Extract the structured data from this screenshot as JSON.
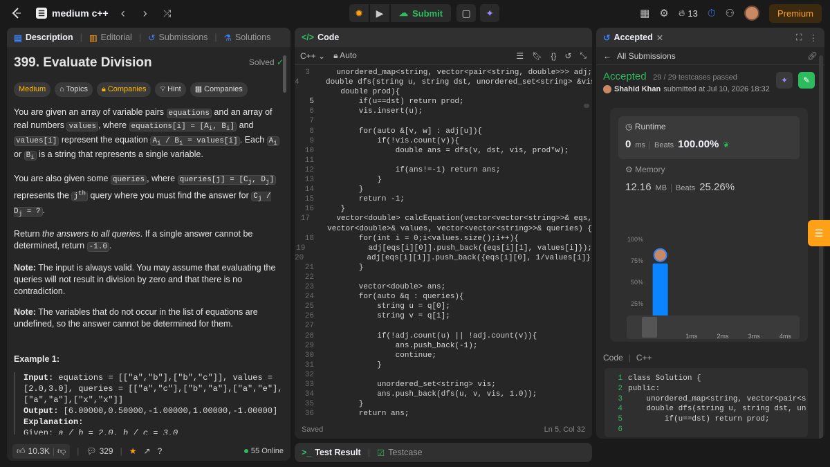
{
  "topbar": {
    "list_title": "medium c++",
    "submit": "Submit",
    "streak": "13",
    "premium": "Premium"
  },
  "desc": {
    "tabs": [
      "Description",
      "Editorial",
      "Submissions",
      "Solutions"
    ],
    "title": "399. Evaluate Division",
    "solved": "Solved",
    "chips": [
      "Medium",
      "Topics",
      "Companies",
      "Hint",
      "Companies"
    ],
    "examples_heading": "Example 1:",
    "footer": {
      "likes": "10.3K",
      "comments": "329",
      "online": "55 Online"
    }
  },
  "code": {
    "tab": "Code",
    "lang": "C++",
    "mode": "Auto",
    "status": "Saved",
    "cursor": "Ln 5, Col 32",
    "lines": [
      {
        "n": "3",
        "t": "    unordered_map<string, vector<pair<string, double>>> adj;"
      },
      {
        "n": "4",
        "t": "    double dfs(string u, string dst, unordered_set<string> &vis,"
      },
      {
        "n": "",
        "t": "    double prod){"
      },
      {
        "n": "5",
        "t": "        if(u==dst) return prod;"
      },
      {
        "n": "6",
        "t": "        vis.insert(u);"
      },
      {
        "n": "7",
        "t": ""
      },
      {
        "n": "8",
        "t": "        for(auto &[v, w] : adj[u]){"
      },
      {
        "n": "9",
        "t": "            if(!vis.count(v)){"
      },
      {
        "n": "10",
        "t": "                double ans = dfs(v, dst, vis, prod*w);"
      },
      {
        "n": "11",
        "t": ""
      },
      {
        "n": "12",
        "t": "                if(ans!=-1) return ans;"
      },
      {
        "n": "13",
        "t": "            }"
      },
      {
        "n": "14",
        "t": "        }"
      },
      {
        "n": "15",
        "t": "        return -1;"
      },
      {
        "n": "16",
        "t": "    }"
      },
      {
        "n": "17",
        "t": "    vector<double> calcEquation(vector<vector<string>>& eqs,"
      },
      {
        "n": "",
        "t": "    vector<double>& values, vector<vector<string>>& queries) {"
      },
      {
        "n": "18",
        "t": "        for(int i = 0;i<values.size();i++){"
      },
      {
        "n": "19",
        "t": "            adj[eqs[i][0]].push_back({eqs[i][1], values[i]});"
      },
      {
        "n": "20",
        "t": "            adj[eqs[i][1]].push_back({eqs[i][0], 1/values[i]});"
      },
      {
        "n": "21",
        "t": "        }"
      },
      {
        "n": "22",
        "t": ""
      },
      {
        "n": "23",
        "t": "        vector<double> ans;"
      },
      {
        "n": "24",
        "t": "        for(auto &q : queries){"
      },
      {
        "n": "25",
        "t": "            string u = q[0];"
      },
      {
        "n": "26",
        "t": "            string v = q[1];"
      },
      {
        "n": "27",
        "t": ""
      },
      {
        "n": "28",
        "t": "            if(!adj.count(u) || !adj.count(v)){"
      },
      {
        "n": "29",
        "t": "                ans.push_back(-1);"
      },
      {
        "n": "30",
        "t": "                continue;"
      },
      {
        "n": "31",
        "t": "            }"
      },
      {
        "n": "32",
        "t": ""
      },
      {
        "n": "33",
        "t": "            unordered_set<string> vis;"
      },
      {
        "n": "34",
        "t": "            ans.push_back(dfs(u, v, vis, 1.0));"
      },
      {
        "n": "35",
        "t": "        }"
      },
      {
        "n": "36",
        "t": "        return ans;"
      }
    ]
  },
  "result": {
    "tabs": [
      "Test Result",
      "Testcase"
    ]
  },
  "accepted": {
    "tab": "Accepted",
    "back": "All Submissions",
    "status": "Accepted",
    "testcases": "29 / 29 testcases passed",
    "user": "Shahid Khan",
    "submitted": "submitted at Jul 10, 2026 18:32",
    "runtime_label": "Runtime",
    "runtime_val": "0",
    "runtime_unit": "ms",
    "beats_label": "Beats",
    "runtime_beats": "100.00%",
    "memory_label": "Memory",
    "memory_val": "12.16",
    "memory_unit": "MB",
    "memory_beats": "25.26%",
    "code_label": "Code",
    "code_lang": "C++",
    "mini_code": [
      {
        "n": "1",
        "t": "class Solution {"
      },
      {
        "n": "2",
        "t": "public:"
      },
      {
        "n": "3",
        "t": "    unordered_map<string, vector<pair<s"
      },
      {
        "n": "4",
        "t": "    double dfs(string u, string dst, un"
      },
      {
        "n": "5",
        "t": "        if(u==dst) return prod;"
      },
      {
        "n": "6",
        "t": ""
      }
    ]
  },
  "chart_data": {
    "type": "bar",
    "categories": [
      "",
      "1ms",
      "2ms",
      "3ms",
      "4ms"
    ],
    "values": [
      72,
      4,
      4,
      10,
      3
    ],
    "yticks": [
      "0%",
      "25%",
      "50%",
      "75%",
      "100%"
    ],
    "ylim": [
      0,
      100
    ],
    "highlight_index": 0
  }
}
